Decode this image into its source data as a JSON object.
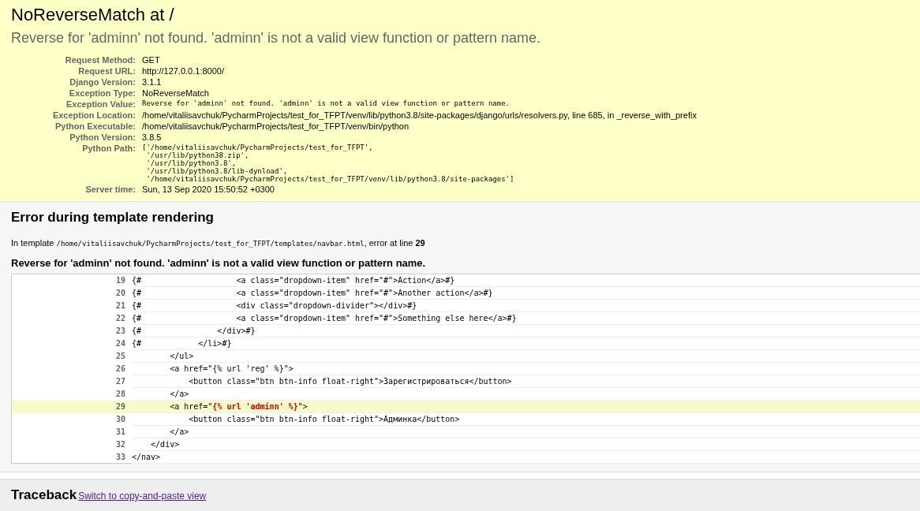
{
  "summary": {
    "title": "NoReverseMatch at /",
    "message": "Reverse for 'adminn' not found. 'adminn' is not a valid view function or pattern name.",
    "meta": [
      {
        "label": "Request Method:",
        "value": "GET",
        "kind": "text"
      },
      {
        "label": "Request URL:",
        "value": "http://127.0.0.1:8000/",
        "kind": "text"
      },
      {
        "label": "Django Version:",
        "value": "3.1.1",
        "kind": "text"
      },
      {
        "label": "Exception Type:",
        "value": "NoReverseMatch",
        "kind": "text"
      },
      {
        "label": "Exception Value:",
        "value": "Reverse for 'adminn' not found. 'adminn' is not a valid view function or pattern name.",
        "kind": "code"
      },
      {
        "label": "Exception Location:",
        "value": "/home/vitaliisavchuk/PycharmProjects/test_for_TFPT/venv/lib/python3.8/site-packages/django/urls/resolvers.py, line 685, in _reverse_with_prefix",
        "kind": "text"
      },
      {
        "label": "Python Executable:",
        "value": "/home/vitaliisavchuk/PycharmProjects/test_for_TFPT/venv/bin/python",
        "kind": "text"
      },
      {
        "label": "Python Version:",
        "value": "3.8.5",
        "kind": "text"
      },
      {
        "label": "Python Path:",
        "value": "['/home/vitaliisavchuk/PycharmProjects/test_for_TFPT',\n '/usr/lib/python38.zip',\n '/usr/lib/python3.8',\n '/usr/lib/python3.8/lib-dynload',\n '/home/vitaliisavchuk/PycharmProjects/test_for_TFPT/venv/lib/python3.8/site-packages']",
        "kind": "code"
      },
      {
        "label": "Server time:",
        "value": "Sun, 13 Sep 2020 15:50:52 +0300",
        "kind": "text"
      }
    ]
  },
  "template": {
    "title": "Error during template rendering",
    "intro": "In template",
    "path": "/home/vitaliisavchuk/PycharmProjects/test_for_TFPT/templates/navbar.html",
    "at": ", error at line",
    "line": "29",
    "message": "Reverse for 'adminn' not found. 'adminn' is not a valid view function or pattern name.",
    "lines": [
      {
        "number": "19",
        "selected": false,
        "code": "{#                    <a class=\"dropdown-item\" href=\"#\">Action</a>#}"
      },
      {
        "number": "20",
        "selected": false,
        "code": "{#                    <a class=\"dropdown-item\" href=\"#\">Another action</a>#}"
      },
      {
        "number": "21",
        "selected": false,
        "code": "{#                    <div class=\"dropdown-divider\"></div>#}"
      },
      {
        "number": "22",
        "selected": false,
        "code": "{#                    <a class=\"dropdown-item\" href=\"#\">Something else here</a>#}"
      },
      {
        "number": "23",
        "selected": false,
        "code": "{#                </div>#}"
      },
      {
        "number": "24",
        "selected": false,
        "code": "{#            </li>#}"
      },
      {
        "number": "25",
        "selected": false,
        "code": "        </ul>"
      },
      {
        "number": "26",
        "selected": false,
        "code": "        <a href=\"{% url 'reg' %}\">"
      },
      {
        "number": "27",
        "selected": false,
        "code": "            <button class=\"btn btn-info float-right\">Зарегистрироваться</button>"
      },
      {
        "number": "28",
        "selected": false,
        "code": "        </a>"
      },
      {
        "number": "29",
        "selected": true,
        "code": "        <a href=\"",
        "error": "{% url 'adminn' %}",
        "after": "\">"
      },
      {
        "number": "30",
        "selected": false,
        "code": "            <button class=\"btn btn-info float-right\">Админка</button>"
      },
      {
        "number": "31",
        "selected": false,
        "code": "        </a>"
      },
      {
        "number": "32",
        "selected": false,
        "code": "    </div>"
      },
      {
        "number": "33",
        "selected": false,
        "code": "</nav>"
      }
    ]
  },
  "traceback": {
    "title": "Traceback",
    "link": "Switch to copy-and-paste view"
  }
}
